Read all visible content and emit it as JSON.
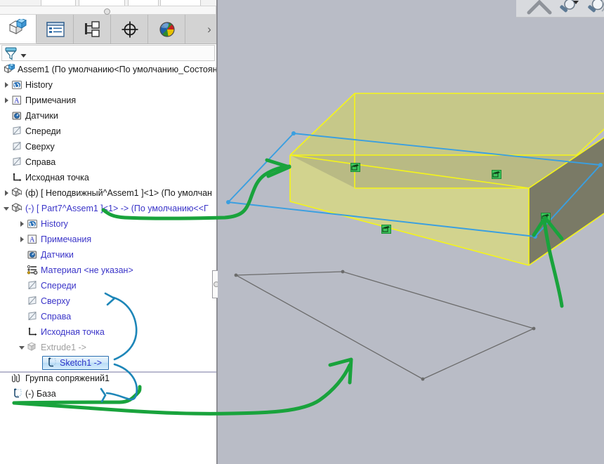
{
  "app": {
    "type": "cad-assembly-feature-tree",
    "background_viewport": "#b9bcc6",
    "panel_background": "#ffffff"
  },
  "tabs": [
    {
      "id": "feature-manager",
      "label": "FeatureManager",
      "icon": "assembly-cube-icon",
      "selected": true
    },
    {
      "id": "property-manager",
      "label": "PropertyManager",
      "icon": "property-list-icon",
      "selected": false
    },
    {
      "id": "configuration-manager",
      "label": "ConfigurationManager",
      "icon": "configuration-tree-icon",
      "selected": false
    },
    {
      "id": "dimxpert-manager",
      "label": "DimXpertManager",
      "icon": "crosshair-target-icon",
      "selected": false
    },
    {
      "id": "display-manager",
      "label": "DisplayManager",
      "icon": "color-sphere-icon",
      "selected": false
    }
  ],
  "tab_overflow_label": "›",
  "filter": {
    "icon": "filter-funnel-icon",
    "dropdown_icon": "chevron-down-icon",
    "placeholder": ""
  },
  "tree": {
    "root": {
      "label": "Assem1  (По умолчанию<По умолчанию_Состоян",
      "icon": "assembly-icon"
    },
    "items": [
      {
        "label": "History",
        "icon": "history-icon",
        "indent": 1,
        "twisty": "closed",
        "color": "black"
      },
      {
        "label": "Примечания",
        "icon": "annotations-icon",
        "indent": 1,
        "twisty": "closed",
        "color": "black"
      },
      {
        "label": "Датчики",
        "icon": "sensors-icon",
        "indent": 1,
        "twisty": "none",
        "color": "black"
      },
      {
        "label": "Спереди",
        "icon": "plane-icon",
        "indent": 1,
        "twisty": "none",
        "color": "black"
      },
      {
        "label": "Сверху",
        "icon": "plane-icon",
        "indent": 1,
        "twisty": "none",
        "color": "black"
      },
      {
        "label": "Справа",
        "icon": "plane-icon",
        "indent": 1,
        "twisty": "none",
        "color": "black"
      },
      {
        "label": "Исходная точка",
        "icon": "origin-icon",
        "indent": 1,
        "twisty": "none",
        "color": "black"
      },
      {
        "label": "(ф) [ Неподвижный^Assem1 ]<1> (По умолчан",
        "icon": "part-icon",
        "indent": 1,
        "twisty": "closed",
        "color": "black"
      },
      {
        "label": "(-) [ Part7^Assem1 ]<1> -> (По умолчанию<<Г",
        "icon": "part-icon",
        "indent": 1,
        "twisty": "open",
        "color": "blue"
      },
      {
        "label": "History",
        "icon": "history-icon",
        "indent": 2,
        "twisty": "closed",
        "color": "blue"
      },
      {
        "label": "Примечания",
        "icon": "annotations-icon",
        "indent": 2,
        "twisty": "closed",
        "color": "blue"
      },
      {
        "label": "Датчики",
        "icon": "sensors-icon",
        "indent": 2,
        "twisty": "none",
        "color": "blue"
      },
      {
        "label": "Материал <не указан>",
        "icon": "material-icon",
        "indent": 2,
        "twisty": "none",
        "color": "blue"
      },
      {
        "label": "Спереди",
        "icon": "plane-icon",
        "indent": 2,
        "twisty": "none",
        "color": "blue"
      },
      {
        "label": "Сверху",
        "icon": "plane-icon",
        "indent": 2,
        "twisty": "none",
        "color": "blue"
      },
      {
        "label": "Справа",
        "icon": "plane-icon",
        "indent": 2,
        "twisty": "none",
        "color": "blue"
      },
      {
        "label": "Исходная точка",
        "icon": "origin-icon",
        "indent": 2,
        "twisty": "none",
        "color": "blue"
      },
      {
        "label": "Extrude1 ->",
        "icon": "extrude-icon",
        "indent": 2,
        "twisty": "open",
        "color": "grey"
      },
      {
        "label": "Sketch1 ->",
        "icon": "sketch-icon",
        "indent": 3,
        "twisty": "none",
        "color": "blue",
        "selected": true
      },
      {
        "label": "Группа сопряжений1",
        "icon": "mategroup-icon",
        "indent": 1,
        "twisty": "none",
        "color": "black"
      },
      {
        "label": "(-) База",
        "icon": "sketch-icon",
        "indent": 1,
        "twisty": "none",
        "color": "black"
      }
    ]
  },
  "viewport": {
    "solid": {
      "name": "extruded-box",
      "top_face_color": "#c6c889",
      "front_face_color": "#d2d38e",
      "inner_face_color": "#b5b580",
      "right_face_color": "#7a7a66",
      "edge_color": "#f5f518",
      "sketch_edge_color": "#3a9fe0"
    },
    "plane_sketch": {
      "name": "reference-plane-parallelogram",
      "edge_color": "#6b6b6b"
    },
    "relation_icons_count": 4,
    "relation_icon_color": "#3cc45b"
  },
  "annotations": {
    "markup_color_green": "#19a33c",
    "markup_color_blue": "#1d86b8",
    "green_arrows": 2,
    "blue_arrows": 2
  }
}
